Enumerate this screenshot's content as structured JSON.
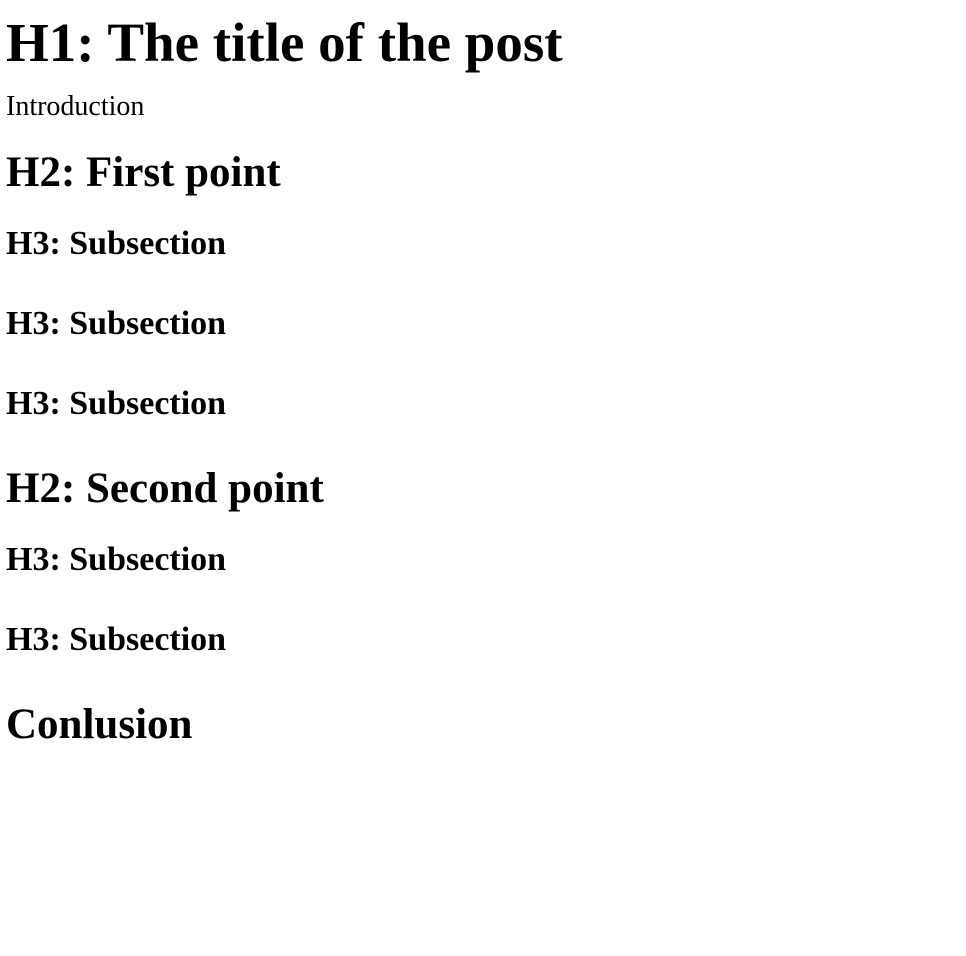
{
  "document": {
    "title": "H1: The title of the post",
    "introduction": "Introduction",
    "sections": [
      {
        "heading": "H2: First point",
        "subsections": [
          "H3: Subsection",
          "H3: Subsection",
          "H3: Subsection"
        ]
      },
      {
        "heading": "H2: Second point",
        "subsections": [
          "H3: Subsection",
          "H3: Subsection"
        ]
      }
    ],
    "conclusion": "Conlusion"
  }
}
